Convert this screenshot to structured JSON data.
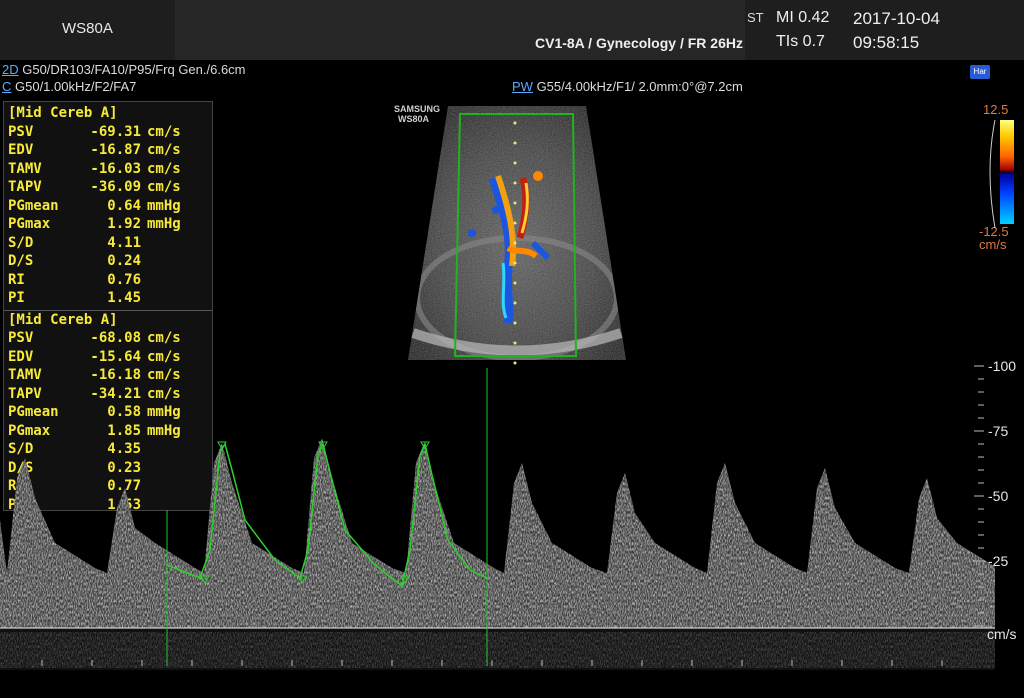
{
  "header": {
    "brand": "WS80A",
    "probe_preset": "CV1-8A / Gynecology / FR 26Hz",
    "st_fragment": "ST",
    "mi": "MI  0.42",
    "tis": "TIs 0.7",
    "date": "2017-10-04",
    "time": "09:58:15"
  },
  "params": {
    "mode_2d": "2D",
    "line_2d": " G50/DR103/FA10/P95/Frq Gen./6.6cm",
    "mode_c": "C",
    "line_c": " G50/1.00kHz/F2/FA7",
    "mode_pw": "PW",
    "line_pw": " G55/4.00kHz/F1/ 2.0mm:0°@7.2cm",
    "harmonic_badge": "Har"
  },
  "image_watermark": {
    "line1": "SAMSUNG",
    "line2": "WS80A"
  },
  "measurements": [
    {
      "title": "[Mid Cereb A]",
      "rows": [
        {
          "label": "PSV",
          "value": "-69.31",
          "unit": "cm/s"
        },
        {
          "label": "EDV",
          "value": "-16.87",
          "unit": "cm/s"
        },
        {
          "label": "TAMV",
          "value": "-16.03",
          "unit": "cm/s"
        },
        {
          "label": "TAPV",
          "value": "-36.09",
          "unit": "cm/s"
        },
        {
          "label": "PGmean",
          "value": "0.64",
          "unit": "mmHg"
        },
        {
          "label": "PGmax",
          "value": "1.92",
          "unit": "mmHg"
        },
        {
          "label": "S/D",
          "value": "4.11",
          "unit": ""
        },
        {
          "label": "D/S",
          "value": "0.24",
          "unit": ""
        },
        {
          "label": "RI",
          "value": "0.76",
          "unit": ""
        },
        {
          "label": "PI",
          "value": "1.45",
          "unit": ""
        }
      ]
    },
    {
      "title": "[Mid Cereb A]",
      "rows": [
        {
          "label": "PSV",
          "value": "-68.08",
          "unit": "cm/s"
        },
        {
          "label": "EDV",
          "value": "-15.64",
          "unit": "cm/s"
        },
        {
          "label": "TAMV",
          "value": "-16.18",
          "unit": "cm/s"
        },
        {
          "label": "TAPV",
          "value": "-34.21",
          "unit": "cm/s"
        },
        {
          "label": "PGmean",
          "value": "0.58",
          "unit": "mmHg"
        },
        {
          "label": "PGmax",
          "value": "1.85",
          "unit": "mmHg"
        },
        {
          "label": "S/D",
          "value": "4.35",
          "unit": ""
        },
        {
          "label": "D/S",
          "value": "0.23",
          "unit": ""
        },
        {
          "label": "RI",
          "value": "0.77",
          "unit": ""
        },
        {
          "label": "PI",
          "value": "1.53",
          "unit": ""
        }
      ]
    }
  ],
  "color_bar": {
    "top": "12.5",
    "bottom": "-12.5",
    "unit": "cm/s"
  },
  "velocity_scale": {
    "s100": "-100",
    "s75": "-75",
    "s50": "-50",
    "s25": "-25",
    "unit": "cm/s"
  },
  "colors": {
    "trace": "#2bd12b",
    "measure_text": "#f7ea3a",
    "mode_link": "#5aa9ff",
    "scale_number": "#e07a3a"
  }
}
